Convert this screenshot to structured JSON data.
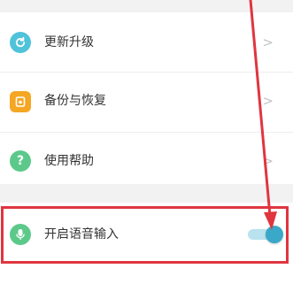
{
  "settings": {
    "items": [
      {
        "label": "更新升级",
        "icon": "refresh-icon",
        "color": "#4fc3d9"
      },
      {
        "label": "备份与恢复",
        "icon": "backup-icon",
        "color": "#f5a623"
      },
      {
        "label": "使用帮助",
        "icon": "help-icon",
        "color": "#5cc98a"
      }
    ],
    "chevron": ">",
    "voice": {
      "label": "开启语音输入",
      "icon": "microphone-icon",
      "color": "#5cc98a",
      "enabled": true
    }
  },
  "colors": {
    "toggle_on": "#3aa8c8",
    "annotation": "#e0353f"
  }
}
